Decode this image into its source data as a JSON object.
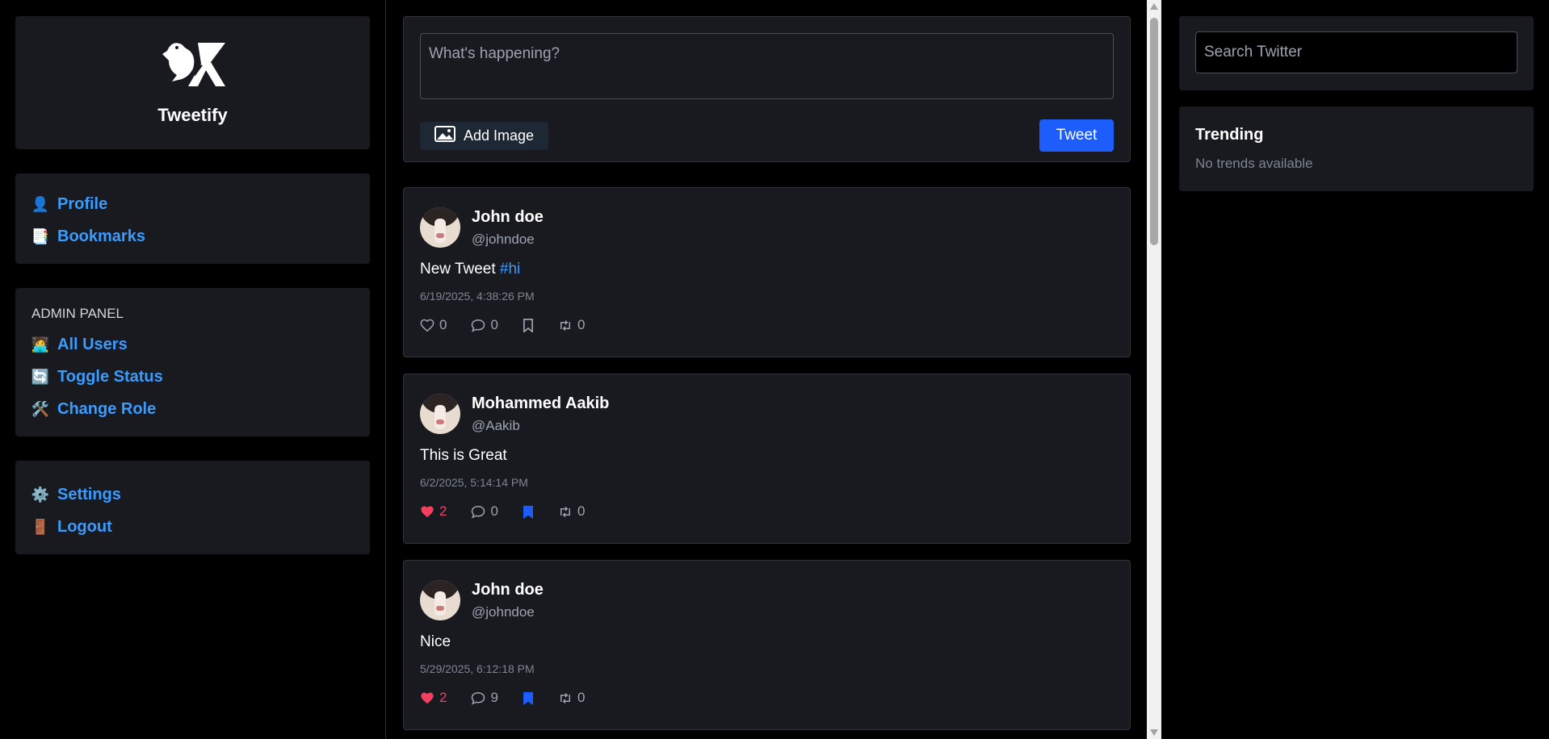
{
  "brand": {
    "name": "Tweetify",
    "logo_icon": "bird-x-logo-icon"
  },
  "nav": [
    {
      "emoji": "👤",
      "label": "Profile"
    },
    {
      "emoji": "📑",
      "label": "Bookmarks"
    }
  ],
  "admin": {
    "title": "ADMIN PANEL",
    "items": [
      {
        "emoji": "🧑‍💻",
        "label": "All Users"
      },
      {
        "emoji": "🔄",
        "label": "Toggle Status"
      },
      {
        "emoji": "🛠️",
        "label": "Change Role"
      }
    ]
  },
  "settings_nav": [
    {
      "emoji": "⚙️",
      "label": "Settings"
    },
    {
      "emoji": "🚪",
      "label": "Logout"
    }
  ],
  "compose": {
    "placeholder": "What's happening?",
    "add_image_label": "Add Image",
    "tweet_label": "Tweet"
  },
  "tweets": [
    {
      "name": "John doe",
      "handle": "@johndoe",
      "text": "New Tweet ",
      "hashtag": "#hi",
      "time": "6/19/2025, 4:38:26 PM",
      "likes": "0",
      "comments": "0",
      "retweets": "0",
      "liked": false,
      "bookmarked": false
    },
    {
      "name": "Mohammed Aakib",
      "handle": "@Aakib",
      "text": "This is Great",
      "hashtag": "",
      "time": "6/2/2025, 5:14:14 PM",
      "likes": "2",
      "comments": "0",
      "retweets": "0",
      "liked": true,
      "bookmarked": true
    },
    {
      "name": "John doe",
      "handle": "@johndoe",
      "text": "Nice",
      "hashtag": "",
      "time": "5/29/2025, 6:12:18 PM",
      "likes": "2",
      "comments": "9",
      "retweets": "0",
      "liked": true,
      "bookmarked": true
    }
  ],
  "search": {
    "placeholder": "Search Twitter"
  },
  "trending": {
    "title": "Trending",
    "empty_text": "No trends available"
  },
  "colors": {
    "accent": "#1d5dfb",
    "link": "#3b9cff",
    "like": "#f43f5e",
    "panel": "#181a20"
  }
}
